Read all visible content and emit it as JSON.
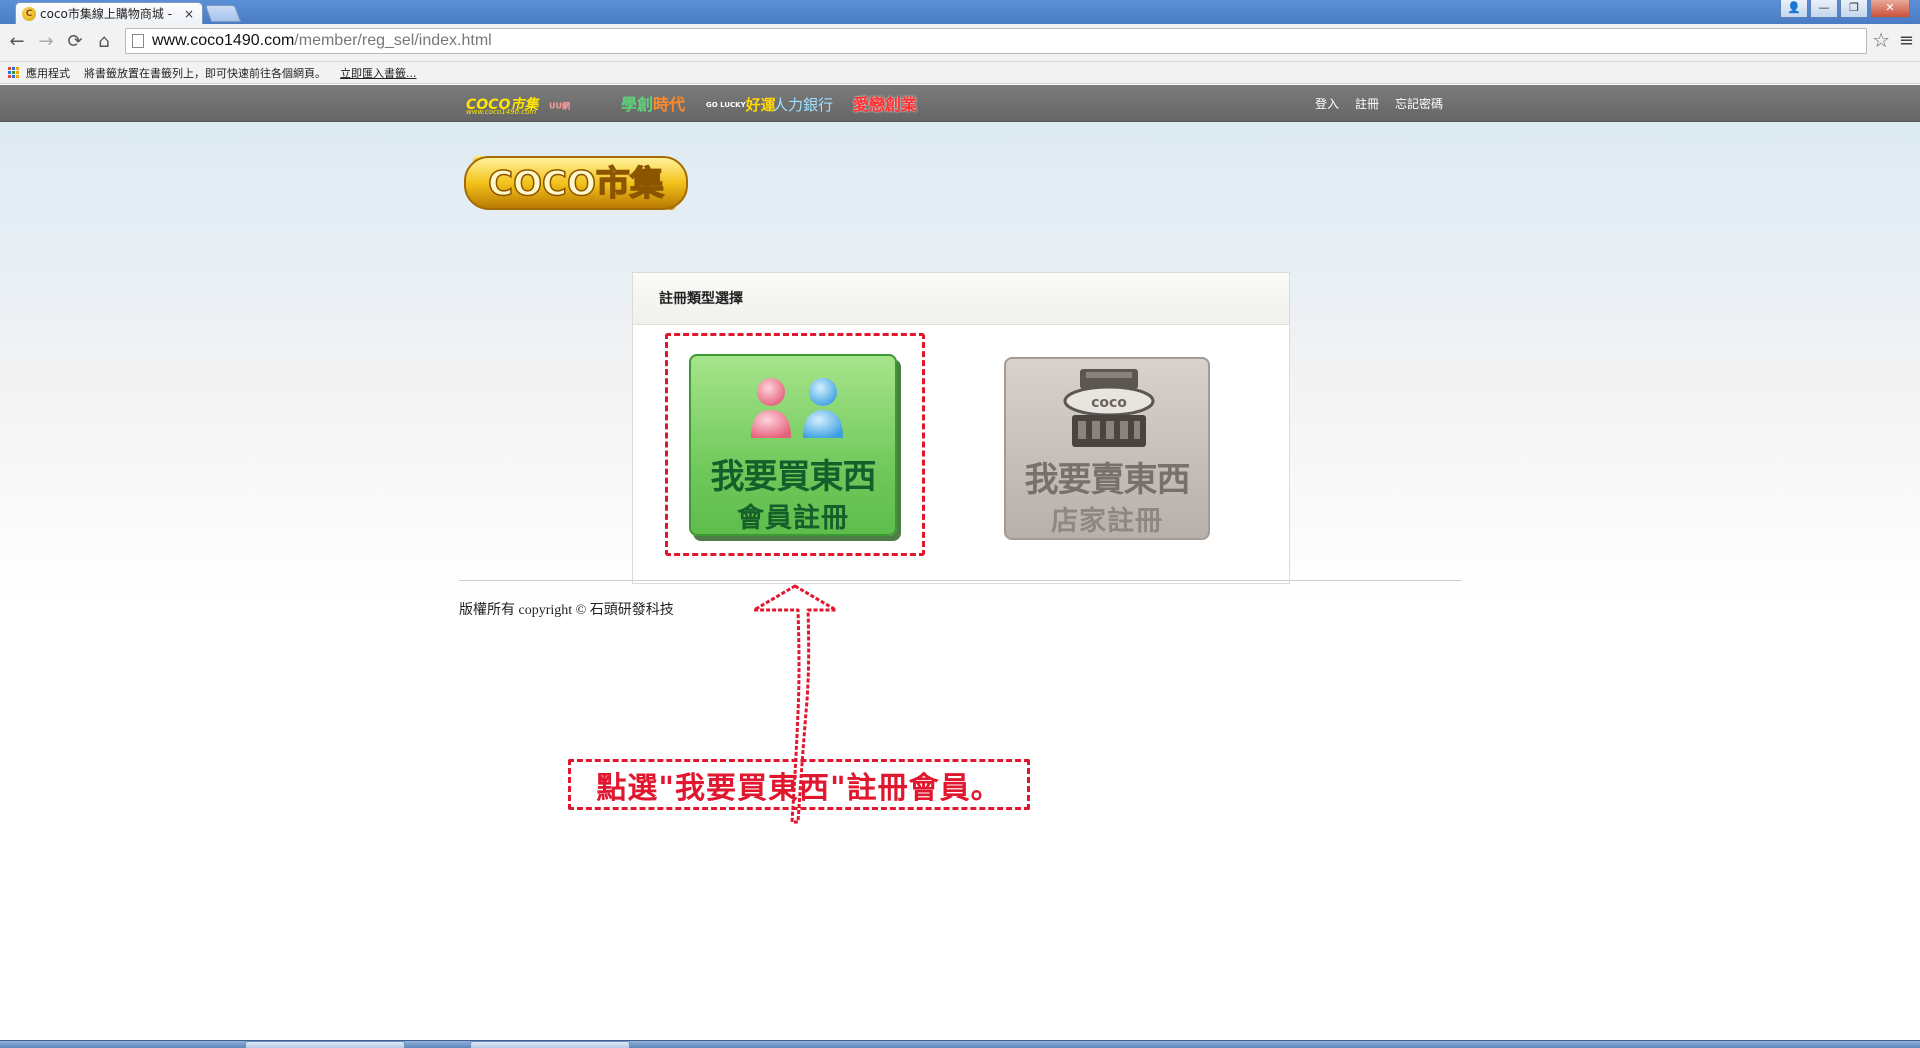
{
  "browser": {
    "tab_title": "coco市集線上購物商城 - ",
    "tab_close": "×",
    "window_buttons": [
      "👤",
      "—",
      "❐",
      "✕"
    ],
    "url_host": "www.coco1490.com",
    "url_path": "/member/reg_sel/index.html",
    "back": "←",
    "forward": "→",
    "reload": "⟳",
    "home": "⌂",
    "star": "☆",
    "menu": "≡"
  },
  "bookmarks": {
    "apps_label": "應用程式",
    "hint": "將書籤放置在書籤列上，即可快速前往各個網頁。",
    "import_link": "立即匯入書籤..."
  },
  "sitebar": {
    "logos": {
      "coco": "COCO市集",
      "coco_small": "www.coco1490.com",
      "uu": "UU",
      "uu_small": "網",
      "edu_a": "學創",
      "edu_b": "時代",
      "luck_small": "GO LUCKY",
      "luck": "好運",
      "job": "人力銀行",
      "love": "愛戀創業"
    },
    "links": [
      "登入",
      "註冊",
      "忘記密碼"
    ]
  },
  "brand_logo_text": "COCO市集",
  "panel": {
    "title": "註冊類型選擇",
    "buy": {
      "main": "我要買東西",
      "sub": "會員註冊"
    },
    "sell": {
      "main": "我要賣東西",
      "sub": "店家註冊"
    }
  },
  "footer": {
    "copyright": "版權所有 copyright © 石頭研發科技"
  },
  "annotation": {
    "note": "點選\"我要買東西\"註冊會員。"
  },
  "colors": {
    "annotation_red": "#e0172e",
    "buy_green": "#6fc85a",
    "sell_gray": "#b8b0aa",
    "site_bar": "#6e6e6e"
  }
}
